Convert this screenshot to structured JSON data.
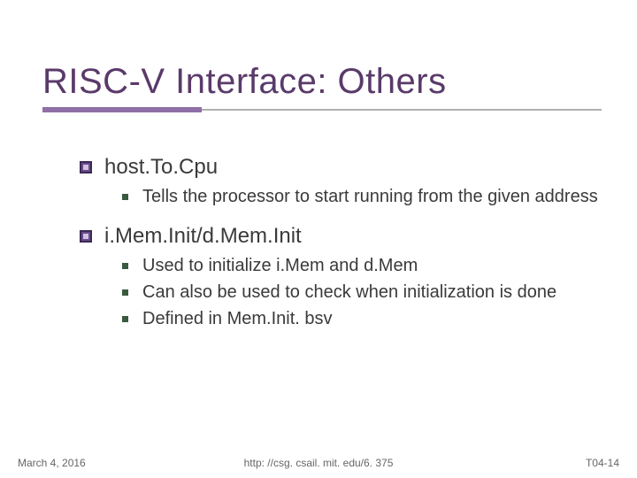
{
  "title": "RISC-V Interface: Others",
  "sections": [
    {
      "heading": "host.To.Cpu",
      "items": [
        "Tells the processor to start running from the given address"
      ]
    },
    {
      "heading": "i.Mem.Init/d.Mem.Init",
      "items": [
        "Used to initialize i.Mem and d.Mem",
        "Can also be used to check when initialization is done",
        "Defined in Mem.Init. bsv"
      ]
    }
  ],
  "footer": {
    "date": "March 4, 2016",
    "url": "http: //csg. csail. mit. edu/6. 375",
    "pageno": "T04-14"
  }
}
